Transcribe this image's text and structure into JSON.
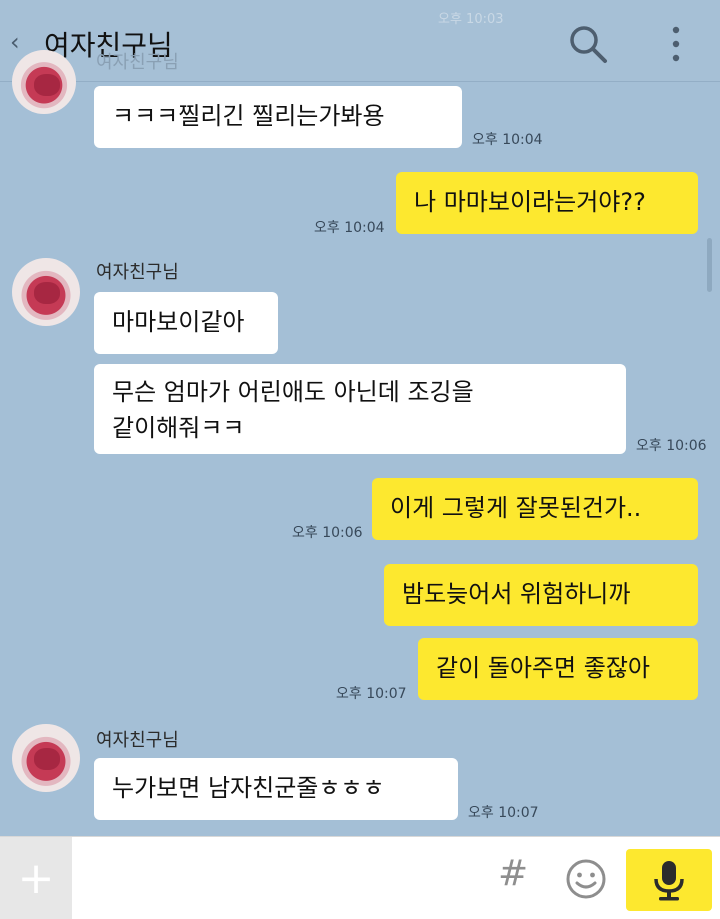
{
  "header": {
    "back_glyph": "‹",
    "title": "여자친구님",
    "faint_time": "오후 10:03"
  },
  "faint_sender": "여자친구님",
  "messages": [
    {
      "side": "left",
      "text": "ㅋㅋㅋ찔리긴 찔리는가봐용",
      "time": "오후 10:04"
    },
    {
      "side": "right",
      "text": "나 마마보이라는거야??",
      "time": "오후 10:04"
    },
    {
      "side": "left",
      "sender": "여자친구님",
      "text": "마마보이같아"
    },
    {
      "side": "left",
      "text_line1": "무슨 엄마가 어린애도 아닌데 조깅을",
      "text_line2": "같이해줘ㅋㅋ",
      "time": "오후 10:06"
    },
    {
      "side": "right",
      "text": "이게 그렇게 잘못된건가..",
      "time": "오후 10:06"
    },
    {
      "side": "right",
      "text": "밤도늦어서 위험하니까"
    },
    {
      "side": "right",
      "text": "같이 돌아주면 좋잖아",
      "time": "오후 10:07"
    },
    {
      "side": "left",
      "sender": "여자친구님",
      "text": "누가보면 남자친군줄ㅎㅎㅎ",
      "time": "오후 10:07"
    }
  ],
  "input_bar": {
    "plus_glyph": "+",
    "hash_glyph": "#"
  },
  "colors": {
    "background": "#a4bfd6",
    "my_bubble": "#fde82f",
    "their_bubble": "#ffffff"
  },
  "icons": [
    "back-chevron-icon",
    "search-icon",
    "more-vert-icon",
    "plus-icon",
    "hash-icon",
    "emoji-icon",
    "mic-icon"
  ]
}
